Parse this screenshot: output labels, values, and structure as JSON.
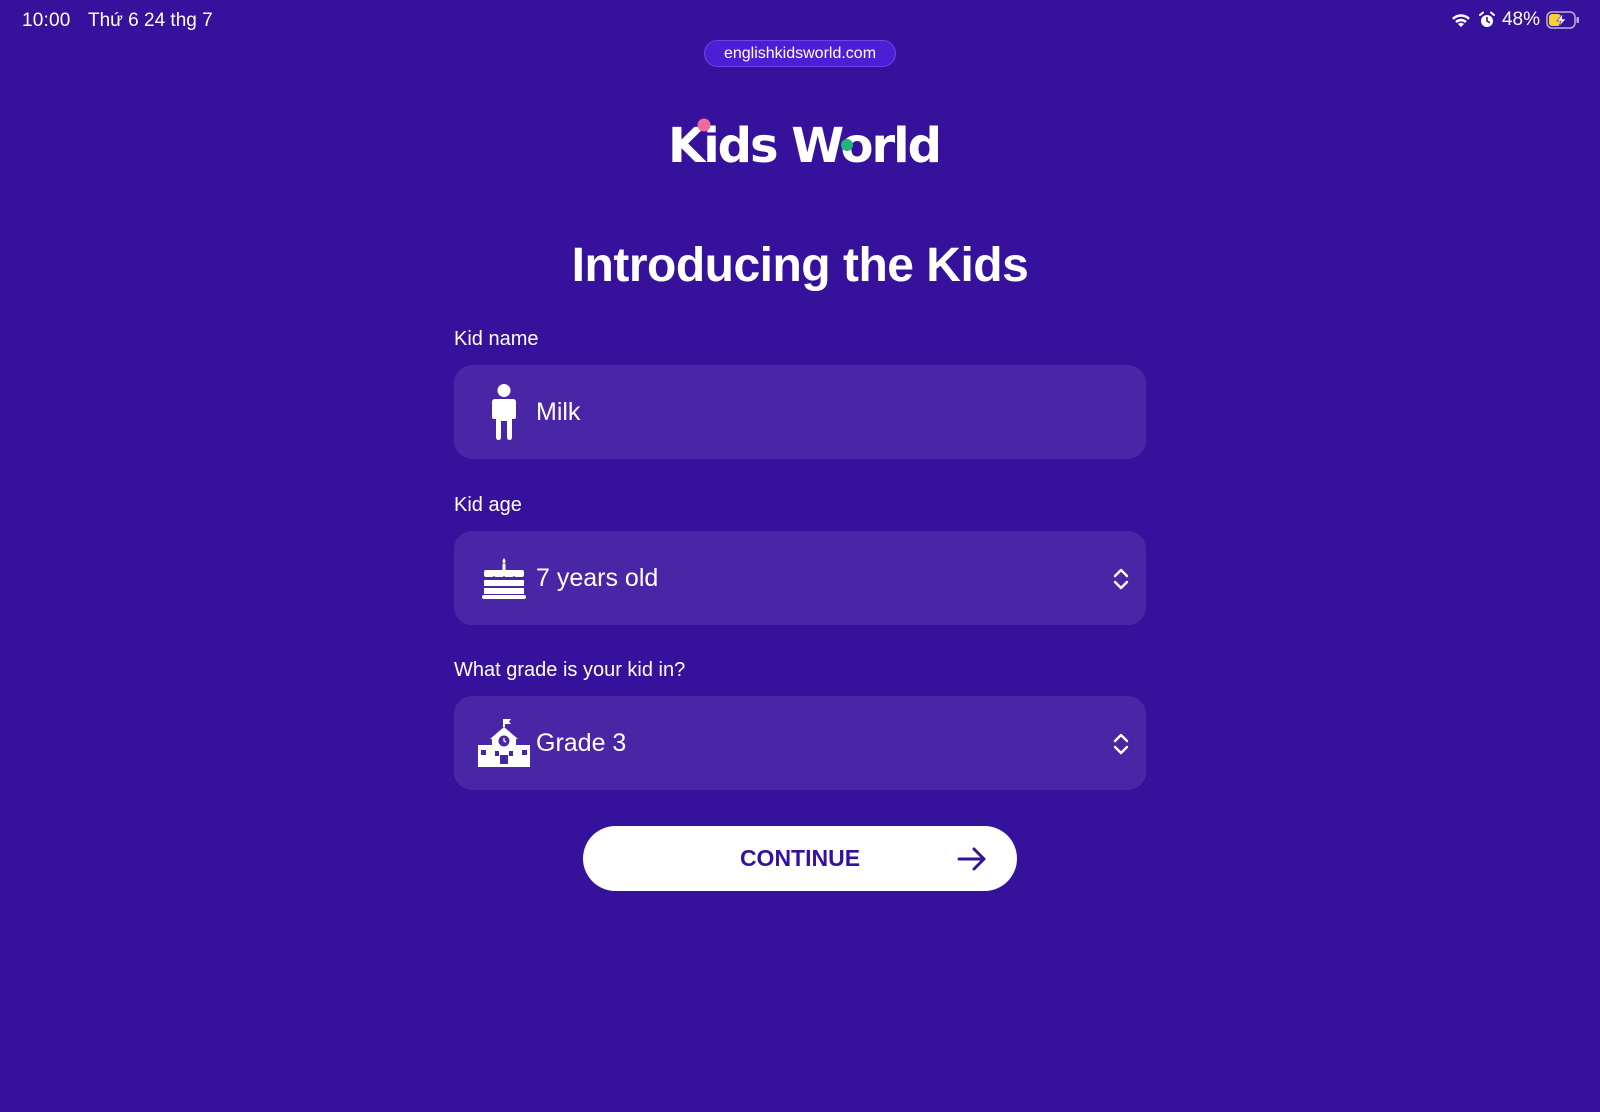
{
  "status_bar": {
    "time": "10:00",
    "date": "Thứ 6 24 thg 7",
    "battery": "48%",
    "icons": [
      "wifi-icon",
      "alarm-icon",
      "battery-charging-icon"
    ]
  },
  "browser": {
    "url": "englishkidsworld.com"
  },
  "logo": {
    "text": "Kids World",
    "dot_colors": {
      "i_dot": "#f06b9b",
      "o_dot": "#21b57a"
    }
  },
  "page": {
    "title": "Introducing the Kids"
  },
  "form": {
    "name": {
      "label": "Kid name",
      "value": "Milk",
      "icon": "child-icon"
    },
    "age": {
      "label": "Kid age",
      "value": "7 years old",
      "icon": "cake-icon"
    },
    "grade": {
      "label": "What grade is your kid in?",
      "value": "Grade 3",
      "icon": "school-icon"
    },
    "continue_label": "CONTINUE"
  },
  "colors": {
    "background": "#36129c",
    "field_background": "#4826a6",
    "url_pill": "#4c1fd6",
    "button": "#ffffff",
    "button_text": "#36129c",
    "battery_fill": "#f5d132"
  }
}
